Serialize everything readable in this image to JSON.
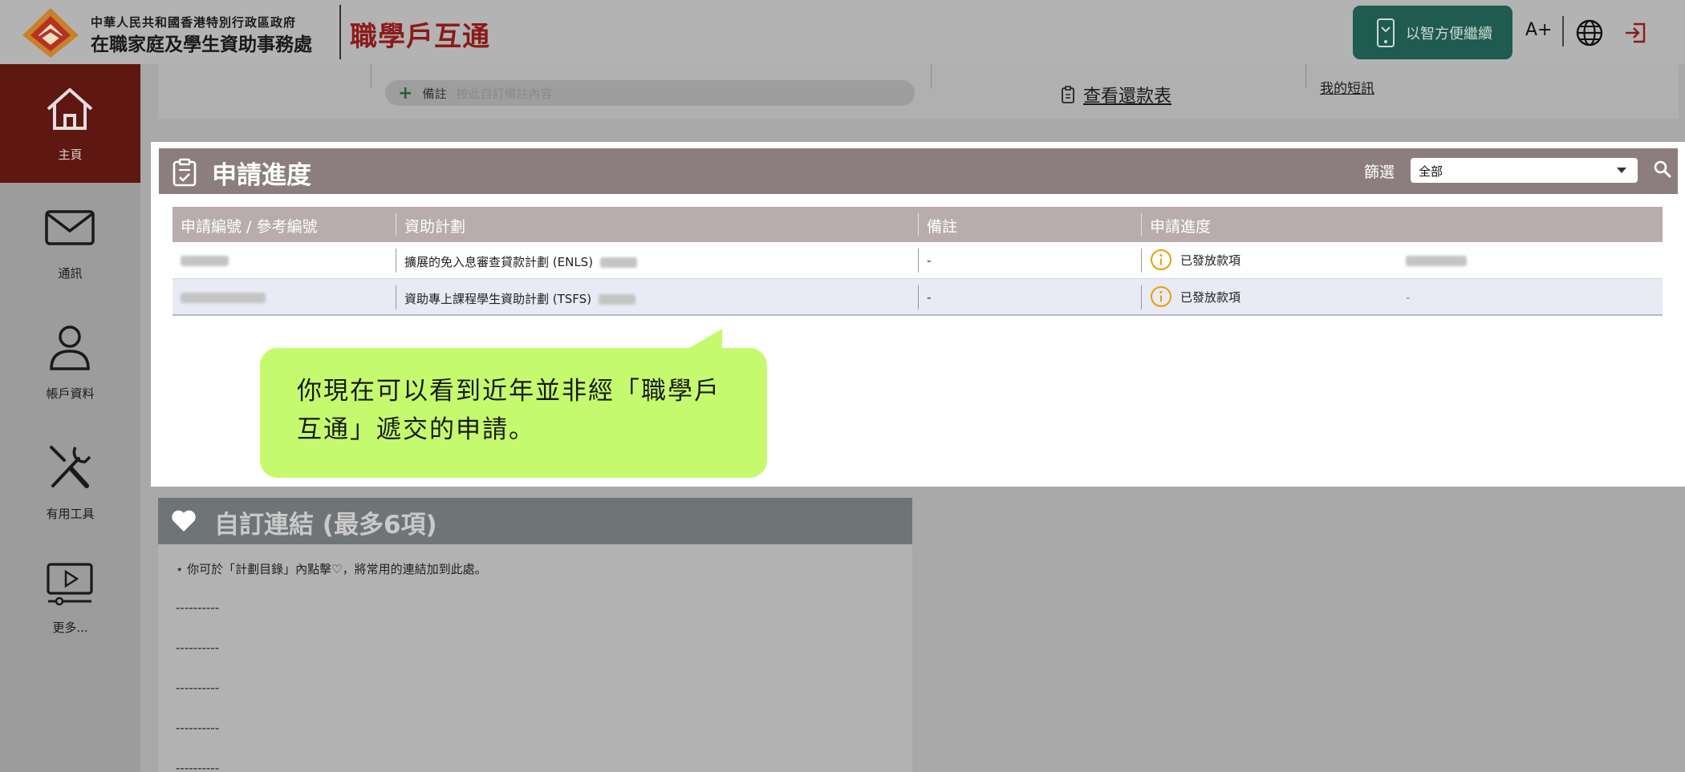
{
  "header": {
    "org_line1": "中華人民共和國香港特別行政區政府",
    "org_line2": "在職家庭及學生資助事務處",
    "brand": "職學戶互通",
    "mobile_button": "以智方便繼續",
    "font_size_button": "A+",
    "icons": [
      "globe-icon",
      "logout-icon",
      "smartphone-icon"
    ]
  },
  "sidebar": {
    "items": [
      {
        "label": "主頁",
        "icon": "home-icon",
        "active": true
      },
      {
        "label": "通訊",
        "icon": "mail-icon",
        "active": false
      },
      {
        "label": "帳戶資料",
        "icon": "user-icon",
        "active": false
      },
      {
        "label": "有用工具",
        "icon": "tools-icon",
        "active": false
      },
      {
        "label": "更多...",
        "icon": "video-icon",
        "active": false
      }
    ]
  },
  "top_strip": {
    "note_plus": "+",
    "note_label": "備註",
    "note_placeholder": "按此自訂備註內容",
    "repayment_link": "查看還款表",
    "sms_link": "我的短訊"
  },
  "progress": {
    "title": "申請進度",
    "filter_label": "篩選",
    "filter_value": "全部",
    "columns": [
      "申請編號 / 參考編號",
      "資助計劃",
      "備註",
      "申請進度"
    ],
    "rows": [
      {
        "scheme": "擴展的免入息審查貸款計劃 (ENLS)",
        "remark": "-",
        "status": "已發放款項",
        "extra": ""
      },
      {
        "scheme": "資助專上課程學生資助計劃 (TSFS)",
        "remark": "-",
        "status": "已發放款項",
        "extra": "-"
      }
    ],
    "status_color": "#e8a000"
  },
  "tooltip": {
    "text": "你現在可以看到近年並非經「職學戶互通」遞交的申請。",
    "color": "#c5fa6f"
  },
  "custom_links": {
    "title": "自訂連結 (最多6項)",
    "hint": "你可於「計劃目錄」內點擊♡，將常用的連結加到此處。",
    "placeholders": [
      "----------",
      "----------",
      "----------",
      "----------",
      "----------"
    ]
  },
  "colors": {
    "sidebar_active": "#5e1711",
    "brand_red": "#8b1a1a",
    "mobile_button_bg": "#1f5c4f",
    "panel_header": "#8c7e7e"
  }
}
